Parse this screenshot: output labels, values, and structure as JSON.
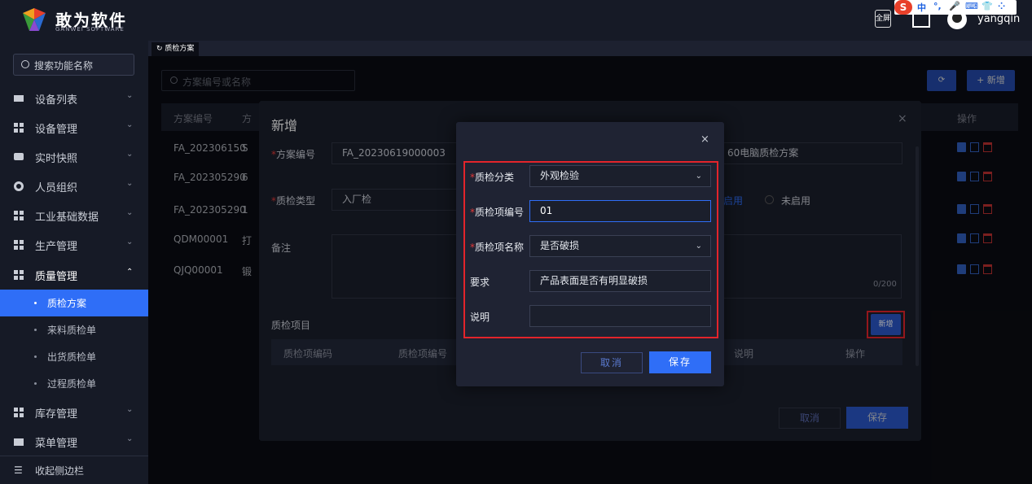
{
  "header": {
    "brand": "敢为软件",
    "brand_sub": "GANWEI SOFTWARE",
    "fullscreen_label": "全屏",
    "username": "yangqin",
    "ime_items": [
      "中",
      "°,",
      "🎤",
      "⌨",
      "👕",
      "⁘"
    ]
  },
  "sidebar": {
    "search_placeholder": "搜索功能名称",
    "items": [
      {
        "label": "设备列表"
      },
      {
        "label": "设备管理"
      },
      {
        "label": "实时快照"
      },
      {
        "label": "人员组织"
      },
      {
        "label": "工业基础数据"
      },
      {
        "label": "生产管理"
      },
      {
        "label": "质量管理"
      }
    ],
    "sub_items": [
      {
        "label": "质检方案"
      },
      {
        "label": "来料质检单"
      },
      {
        "label": "出货质检单"
      },
      {
        "label": "过程质检单"
      }
    ],
    "bottom_items": [
      {
        "label": "库存管理"
      },
      {
        "label": "菜单管理"
      }
    ],
    "collapse_label": "收起侧边栏"
  },
  "tabs": {
    "active": "质检方案"
  },
  "main": {
    "search_placeholder": "方案编号或名称",
    "new_button": "+ 新增",
    "refresh_icon": "⟳",
    "columns": {
      "code": "方案编号",
      "name": "方",
      "actions": "操作"
    },
    "rows": [
      {
        "code": "FA_2023061500",
        "name": "S"
      },
      {
        "code": "FA_2023052900",
        "name": "6"
      },
      {
        "code": "FA_2023052900",
        "name": "1"
      },
      {
        "code": "QDM00001",
        "name": "打"
      },
      {
        "code": "QJQ00001",
        "name": "锻"
      }
    ]
  },
  "dialog1": {
    "title": "新增",
    "close": "×",
    "code_label": "方案编号",
    "code_value": "FA_20230619000003",
    "name_value": "60电脑质检方案",
    "type_label": "质检类型",
    "type_value": "入厂检",
    "enable_label": "启用",
    "disable_label": "未启用",
    "remark_label": "备注",
    "remark_count": "0/200",
    "section_label": "质检项目",
    "add_button": "新增",
    "sub_columns": [
      "质检项编码",
      "质检项编号",
      "说明",
      "操作"
    ],
    "cancel": "取消",
    "save": "保存"
  },
  "dialog2": {
    "close": "×",
    "category_label": "质检分类",
    "category_value": "外观检验",
    "item_code_label": "质检项编号",
    "item_code_value": "01",
    "item_name_label": "质检项名称",
    "item_name_value": "是否破损",
    "requirement_label": "要求",
    "requirement_value": "产品表面是否有明显破损",
    "description_label": "说明",
    "description_value": "",
    "cancel": "取消",
    "save": "保存",
    "required_mark": "*"
  }
}
